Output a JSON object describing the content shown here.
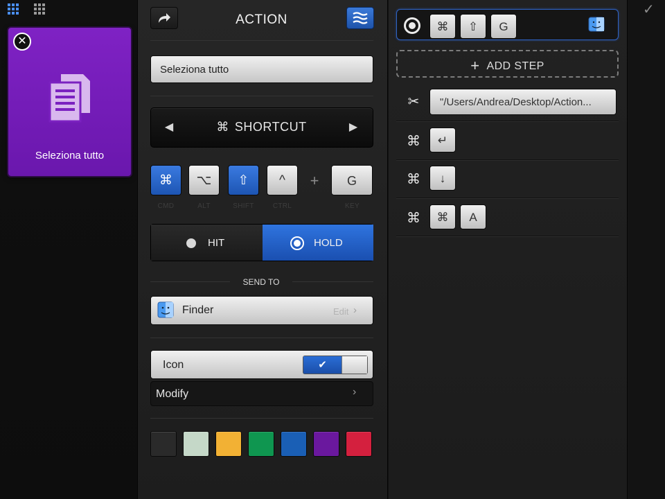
{
  "top_bar": {
    "grid_icon_1": "grid-icon",
    "grid_icon_2": "grid-small-icon",
    "done_icon": "checkmark-icon"
  },
  "tile": {
    "label": "Seleziona tutto",
    "color": "#7b21c0",
    "icon": "document-icon",
    "close_icon": "close-icon",
    "close_glyph": "✕"
  },
  "editor": {
    "title": "ACTION",
    "share_icon": "share-arrow-icon",
    "menu_icon": "menu-lines-icon",
    "name_value": "Seleziona tutto",
    "type": {
      "label": "SHORTCUT",
      "glyph": "⌘",
      "prev": "◀",
      "next": "▶"
    },
    "modifiers": [
      {
        "glyph": "⌘",
        "caption": "CMD",
        "active": true
      },
      {
        "glyph": "⌥",
        "caption": "ALT",
        "active": false
      },
      {
        "glyph": "⇧",
        "caption": "SHIFT",
        "active": true
      },
      {
        "glyph": "^",
        "caption": "CTRL",
        "active": false
      }
    ],
    "plus": "+",
    "key": {
      "value": "G",
      "caption": "KEY"
    },
    "mode": {
      "hit": "HIT",
      "hold": "HOLD",
      "selected": "HOLD"
    },
    "send_to": {
      "heading": "SEND TO",
      "app": "Finder",
      "edit": "Edit",
      "chevron": "›"
    },
    "icon_row": {
      "label": "Icon",
      "enabled": true,
      "check": "✔"
    },
    "modify": {
      "label": "Modify",
      "chevron": "›"
    },
    "colors": [
      "#2a2a2a",
      "#c5d8c8",
      "#f2b134",
      "#0f9650",
      "#1a5fb5",
      "#6a189e",
      "#d4203e"
    ]
  },
  "steps": {
    "selected": {
      "keys": [
        "⌘",
        "⇧",
        "G"
      ],
      "app_icon": "finder-icon"
    },
    "add_step": {
      "label": "ADD STEP",
      "plus": "+"
    },
    "rows": [
      {
        "icon": "scissors-icon",
        "glyph": "✂",
        "path": "\"/Users/Andrea/Desktop/Action..."
      },
      {
        "icon": "command-icon",
        "glyph": "⌘",
        "keys": [
          "↵"
        ]
      },
      {
        "icon": "command-icon",
        "glyph": "⌘",
        "keys": [
          "↓"
        ]
      },
      {
        "icon": "command-icon",
        "glyph": "⌘",
        "keys": [
          "⌘",
          "A"
        ]
      }
    ]
  }
}
